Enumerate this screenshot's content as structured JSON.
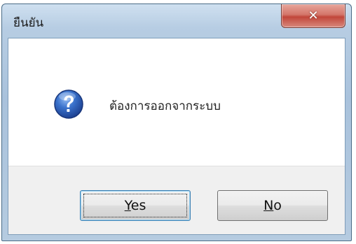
{
  "dialog": {
    "title": "ยืนยัน",
    "close_glyph": "✕",
    "message": "ต้องการออกจากระบบ",
    "icon": "question-icon",
    "buttons": {
      "yes": {
        "mnemonic": "Y",
        "rest": "es"
      },
      "no": {
        "mnemonic": "N",
        "rest": "o"
      }
    }
  },
  "colors": {
    "close_button": "#c7463a",
    "icon_blue": "#2a5db5"
  }
}
